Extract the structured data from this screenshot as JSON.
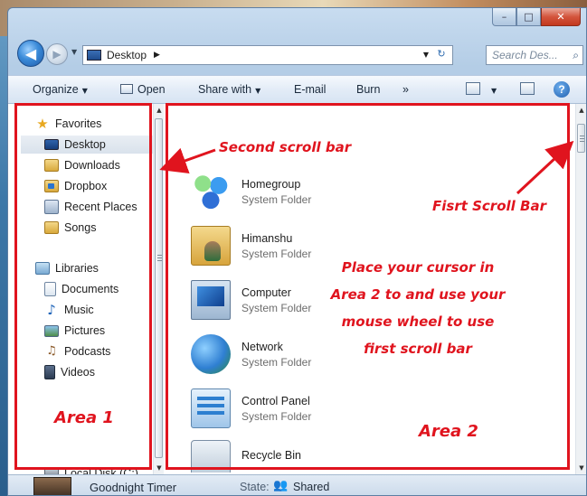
{
  "window": {
    "caption_min": "–",
    "caption_max": "□",
    "caption_close": "✕"
  },
  "nav": {
    "back_glyph": "◀",
    "forward_glyph": "▶",
    "address_label": "Desktop",
    "address_sep": "▶",
    "search_placeholder": "Search Des...",
    "search_glyph": "⌕",
    "refresh_glyph": "↻"
  },
  "toolbar": {
    "organize": "Organize",
    "open": "Open",
    "share_with": "Share with",
    "email": "E-mail",
    "burn": "Burn",
    "more": "»",
    "help": "?"
  },
  "sidebar": {
    "favorites_header": "Favorites",
    "favorites": [
      {
        "label": "Desktop",
        "icon": "desktop-icon"
      },
      {
        "label": "Downloads",
        "icon": "folder-icon"
      },
      {
        "label": "Dropbox",
        "icon": "dropbox-icon"
      },
      {
        "label": "Recent Places",
        "icon": "recent-places-icon"
      },
      {
        "label": "Songs",
        "icon": "folder-icon"
      }
    ],
    "libraries_header": "Libraries",
    "libraries": [
      {
        "label": "Documents",
        "icon": "documents-icon"
      },
      {
        "label": "Music",
        "icon": "music-icon"
      },
      {
        "label": "Pictures",
        "icon": "pictures-icon"
      },
      {
        "label": "Podcasts",
        "icon": "podcasts-icon"
      },
      {
        "label": "Videos",
        "icon": "videos-icon"
      }
    ],
    "partial_item": "Local Disk (C:)"
  },
  "files": [
    {
      "name": "Homegroup",
      "type": "System Folder",
      "icon": "homegroup-icon"
    },
    {
      "name": "Himanshu",
      "type": "System Folder",
      "icon": "user-folder-icon"
    },
    {
      "name": "Computer",
      "type": "System Folder",
      "icon": "computer-icon"
    },
    {
      "name": "Network",
      "type": "System Folder",
      "icon": "network-icon"
    },
    {
      "name": "Control Panel",
      "type": "System Folder",
      "icon": "control-panel-icon"
    },
    {
      "name": "Recycle Bin",
      "type": "",
      "icon": "recycle-bin-icon"
    }
  ],
  "annotations": {
    "second_scroll_bar": "Second scroll bar",
    "first_scroll_bar": "Fisrt Scroll Bar",
    "instruction_lines": [
      "Place your cursor in",
      "Area 2 to and use your",
      "mouse wheel to use",
      "first scroll bar"
    ],
    "area1": "Area 1",
    "area2": "Area 2",
    "color": "#e0141e"
  },
  "statusbar": {
    "name": "Goodnight Timer",
    "state_label": "State:",
    "state_value": "Shared"
  }
}
